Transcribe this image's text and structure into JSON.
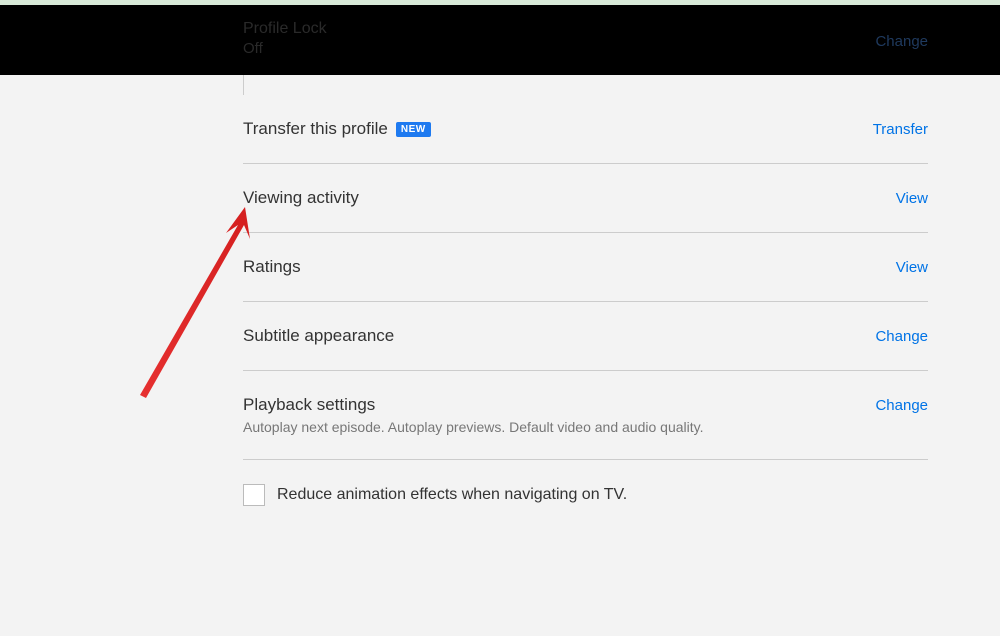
{
  "banner": {
    "title": "Profile Lock",
    "subtitle": "Off",
    "action": "Change"
  },
  "rows": {
    "transfer": {
      "title": "Transfer this profile",
      "badge": "NEW",
      "action": "Transfer"
    },
    "viewing": {
      "title": "Viewing activity",
      "action": "View"
    },
    "ratings": {
      "title": "Ratings",
      "action": "View"
    },
    "subtitle": {
      "title": "Subtitle appearance",
      "action": "Change"
    },
    "playback": {
      "title": "Playback settings",
      "description": "Autoplay next episode. Autoplay previews. Default video and audio quality.",
      "action": "Change"
    }
  },
  "checkbox": {
    "label": "Reduce animation effects when navigating on TV."
  }
}
